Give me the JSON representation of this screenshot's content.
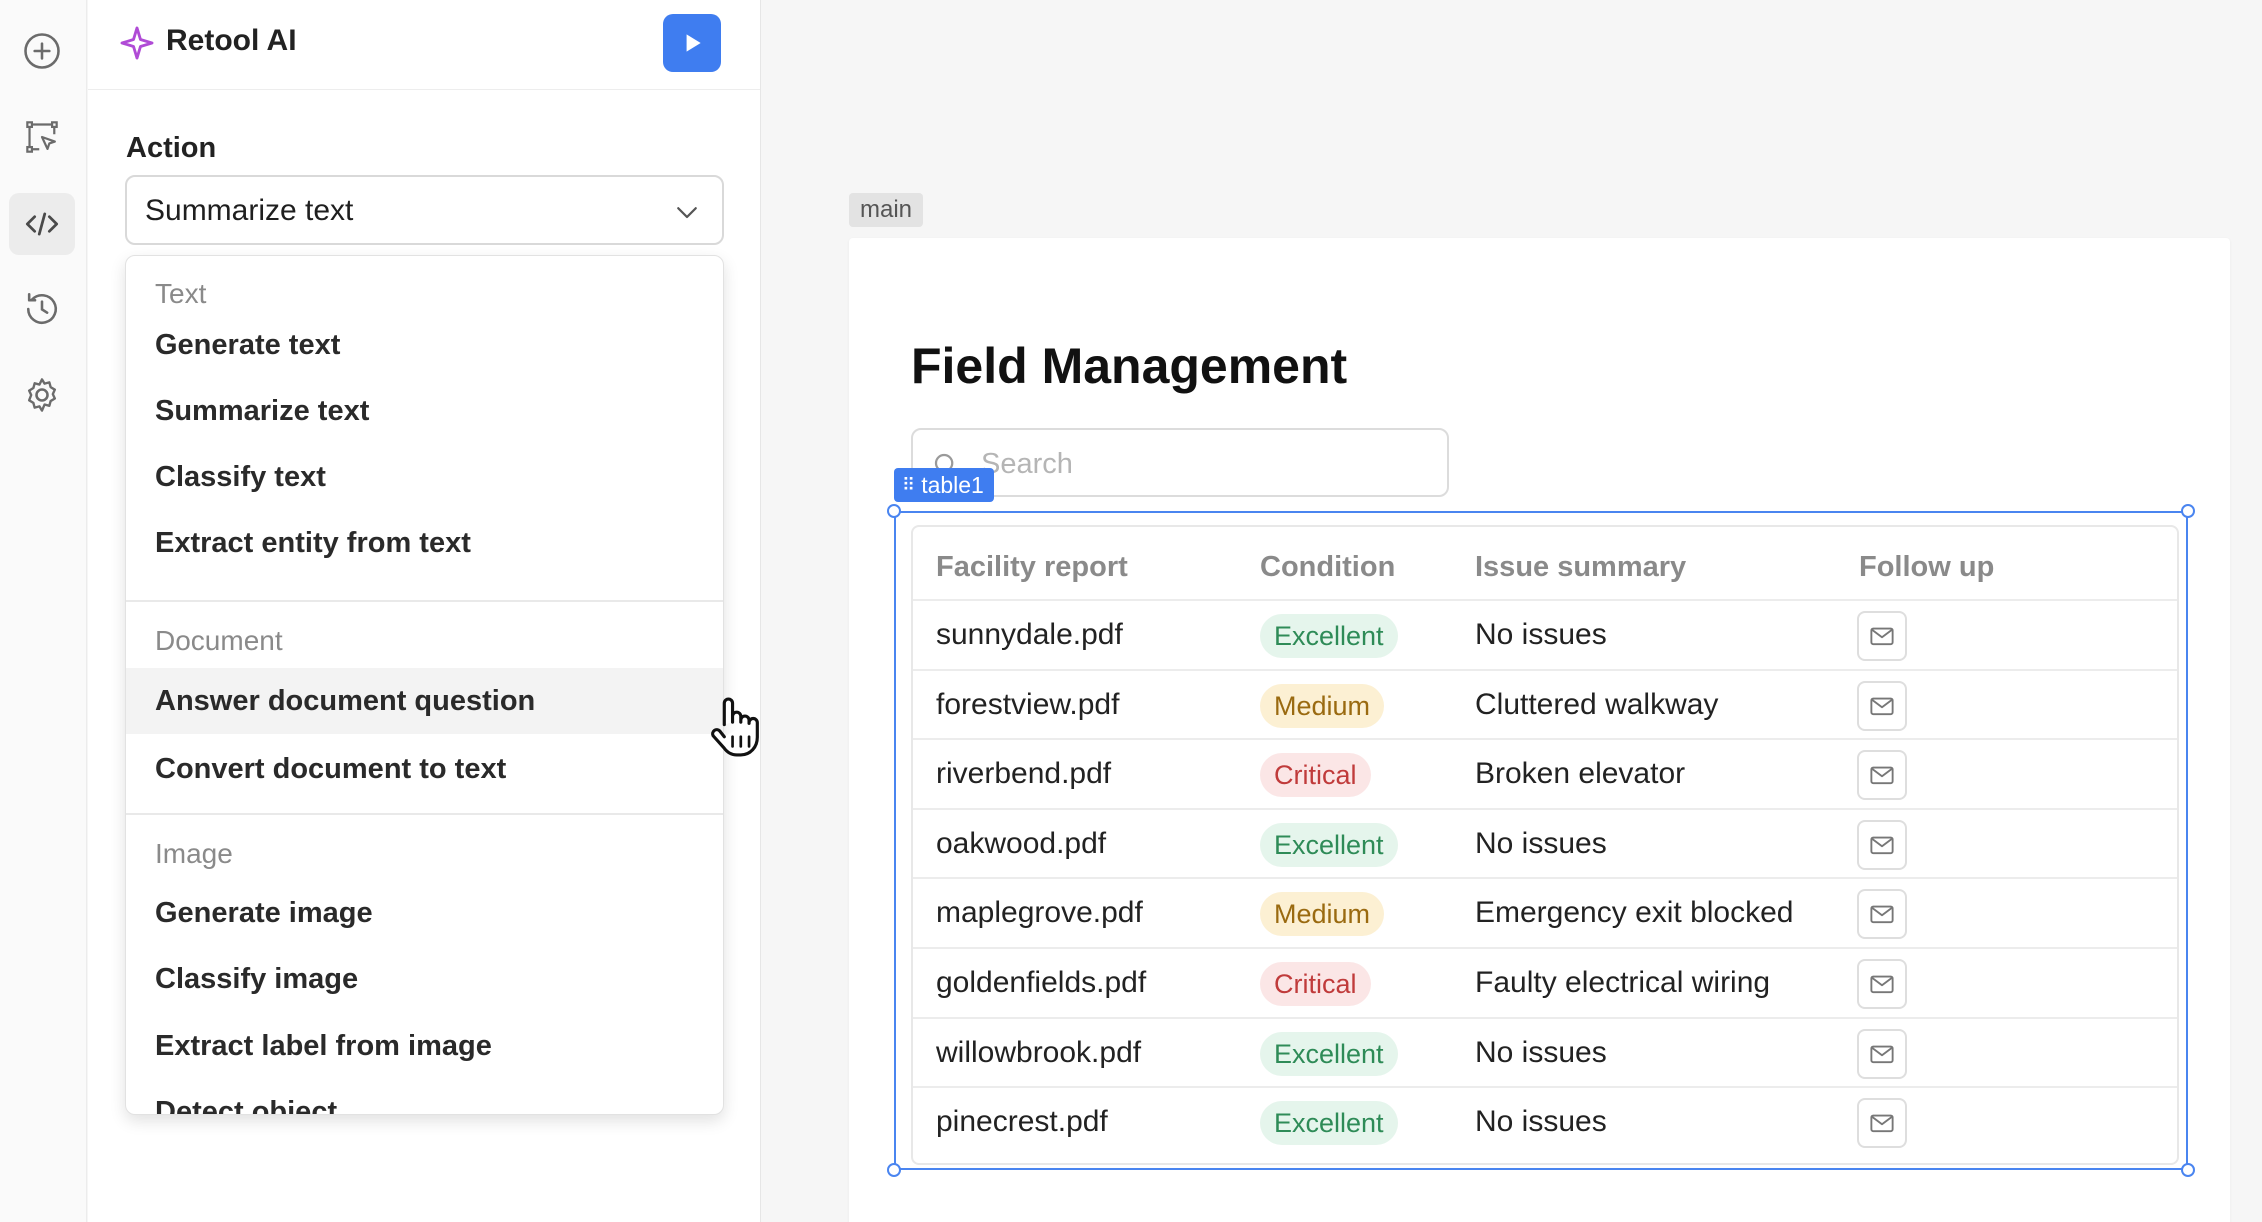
{
  "rail": {
    "items": [
      {
        "icon": "plus-circle-icon"
      },
      {
        "icon": "select-pointer-icon"
      },
      {
        "icon": "code-icon",
        "active": true
      },
      {
        "icon": "history-icon"
      },
      {
        "icon": "gear-icon"
      }
    ]
  },
  "panel": {
    "title": "Retool AI",
    "action_label": "Action",
    "selected_action": "Summarize text",
    "dropdown": {
      "groups": [
        {
          "label": "Text",
          "items": [
            "Generate text",
            "Summarize text",
            "Classify text",
            "Extract entity from text"
          ]
        },
        {
          "label": "Document",
          "items": [
            "Answer document question",
            "Convert document to text"
          ]
        },
        {
          "label": "Image",
          "items": [
            "Generate image",
            "Classify image",
            "Extract label from image",
            "Detect object"
          ]
        }
      ],
      "hovered_item": "Answer document question"
    }
  },
  "canvas": {
    "container_tag": "main",
    "page_title": "Field Management",
    "search": {
      "placeholder": "Search",
      "value": ""
    },
    "selected_component": "table1",
    "table": {
      "columns": [
        "Facility report",
        "Condition",
        "Issue summary",
        "Follow up"
      ],
      "rows": [
        {
          "report": "sunnydale.pdf",
          "condition": "Excellent",
          "level": "ex",
          "summary": "No issues"
        },
        {
          "report": "forestview.pdf",
          "condition": "Medium",
          "level": "md",
          "summary": "Cluttered walkway"
        },
        {
          "report": "riverbend.pdf",
          "condition": "Critical",
          "level": "cr",
          "summary": "Broken elevator"
        },
        {
          "report": "oakwood.pdf",
          "condition": "Excellent",
          "level": "ex",
          "summary": "No issues"
        },
        {
          "report": "maplegrove.pdf",
          "condition": "Medium",
          "level": "md",
          "summary": "Emergency exit blocked"
        },
        {
          "report": "goldenfields.pdf",
          "condition": "Critical",
          "level": "cr",
          "summary": "Faulty electrical wiring"
        },
        {
          "report": "willowbrook.pdf",
          "condition": "Excellent",
          "level": "ex",
          "summary": "No issues"
        },
        {
          "report": "pinecrest.pdf",
          "condition": "Excellent",
          "level": "ex",
          "summary": "No issues"
        }
      ]
    }
  },
  "colors": {
    "accent": "#3f7df0",
    "excellent": "#2e8b57",
    "medium": "#9a6a10",
    "critical": "#c03b3b",
    "ai_sparkle": "#b04bd6"
  }
}
